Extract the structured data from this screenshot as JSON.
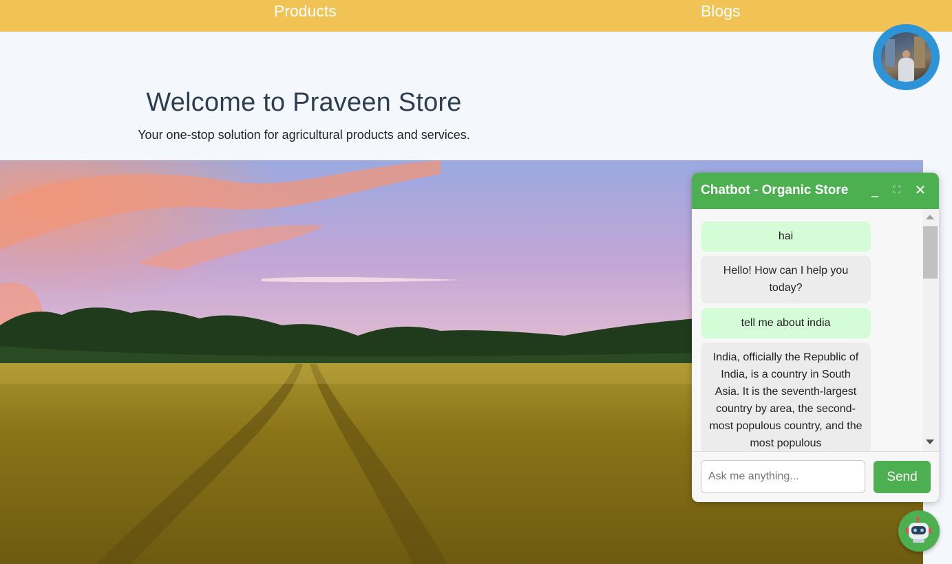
{
  "nav": {
    "products": "Products",
    "blogs": "Blogs"
  },
  "hero": {
    "title": "Welcome to Praveen Store",
    "subtitle": "Your one-stop solution for agricultural products and services."
  },
  "chatbot": {
    "title": "Chatbot - Organic Store",
    "minimize_icon": "_",
    "maximize_icon": "⛶",
    "close_icon": "✕",
    "messages": [
      {
        "role": "user",
        "text": "hai"
      },
      {
        "role": "bot",
        "text": "Hello! How can I help you today?"
      },
      {
        "role": "user",
        "text": "tell me about india"
      },
      {
        "role": "bot",
        "text": "India, officially the Republic of India, is a country in South Asia. It is the seventh-largest country by area, the second-most populous country, and the most populous"
      }
    ],
    "input_placeholder": "Ask me anything...",
    "send_label": "Send"
  },
  "colors": {
    "nav_bg": "#f0c354",
    "chat_accent": "#4caf50",
    "user_bubble": "#d4fcd6",
    "bot_bubble": "#ececec",
    "profile_ring": "#2d94d8"
  },
  "icons": {
    "profile": "avatar",
    "chat_toggle": "robot-icon"
  }
}
